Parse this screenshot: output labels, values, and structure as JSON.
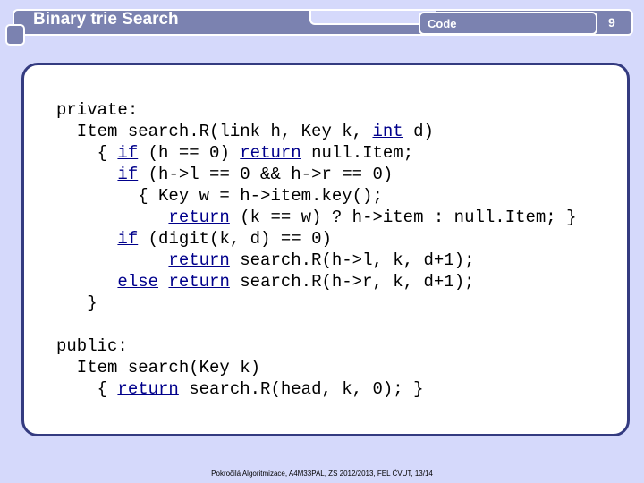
{
  "header": {
    "title": "Binary trie Search",
    "section": "Code",
    "page_number": "9"
  },
  "code_lines": [
    [
      [
        "private:",
        0
      ]
    ],
    [
      [
        "  Item search.R(link h, Key k, ",
        0
      ],
      [
        "int",
        1
      ],
      [
        " d)",
        0
      ]
    ],
    [
      [
        "    { ",
        0
      ],
      [
        "if",
        1
      ],
      [
        " (h == 0) ",
        0
      ],
      [
        "return",
        1
      ],
      [
        " null.Item;",
        0
      ]
    ],
    [
      [
        "      ",
        0
      ],
      [
        "if",
        1
      ],
      [
        " (h->l == 0 && h->r == 0)",
        0
      ]
    ],
    [
      [
        "        { Key w = h->item.key();",
        0
      ]
    ],
    [
      [
        "           ",
        0
      ],
      [
        "return",
        1
      ],
      [
        " (k == w) ? h->item : null.Item; }",
        0
      ]
    ],
    [
      [
        "      ",
        0
      ],
      [
        "if",
        1
      ],
      [
        " (digit(k, d) == 0)",
        0
      ]
    ],
    [
      [
        "           ",
        0
      ],
      [
        "return",
        1
      ],
      [
        " search.R(h->l, k, d+1);",
        0
      ]
    ],
    [
      [
        "      ",
        0
      ],
      [
        "else",
        1
      ],
      [
        " ",
        0
      ],
      [
        "return",
        1
      ],
      [
        " search.R(h->r, k, d+1);",
        0
      ]
    ],
    [
      [
        "   }",
        0
      ]
    ],
    [
      [
        "",
        0
      ]
    ],
    [
      [
        "public:",
        0
      ]
    ],
    [
      [
        "  Item search(Key k)",
        0
      ]
    ],
    [
      [
        "    { ",
        0
      ],
      [
        "return",
        1
      ],
      [
        " search.R(head, k, 0); }",
        0
      ]
    ]
  ],
  "footer": "Pokročilá Algoritmizace, A4M33PAL, ZS 2012/2013, FEL ČVUT, 13/14"
}
